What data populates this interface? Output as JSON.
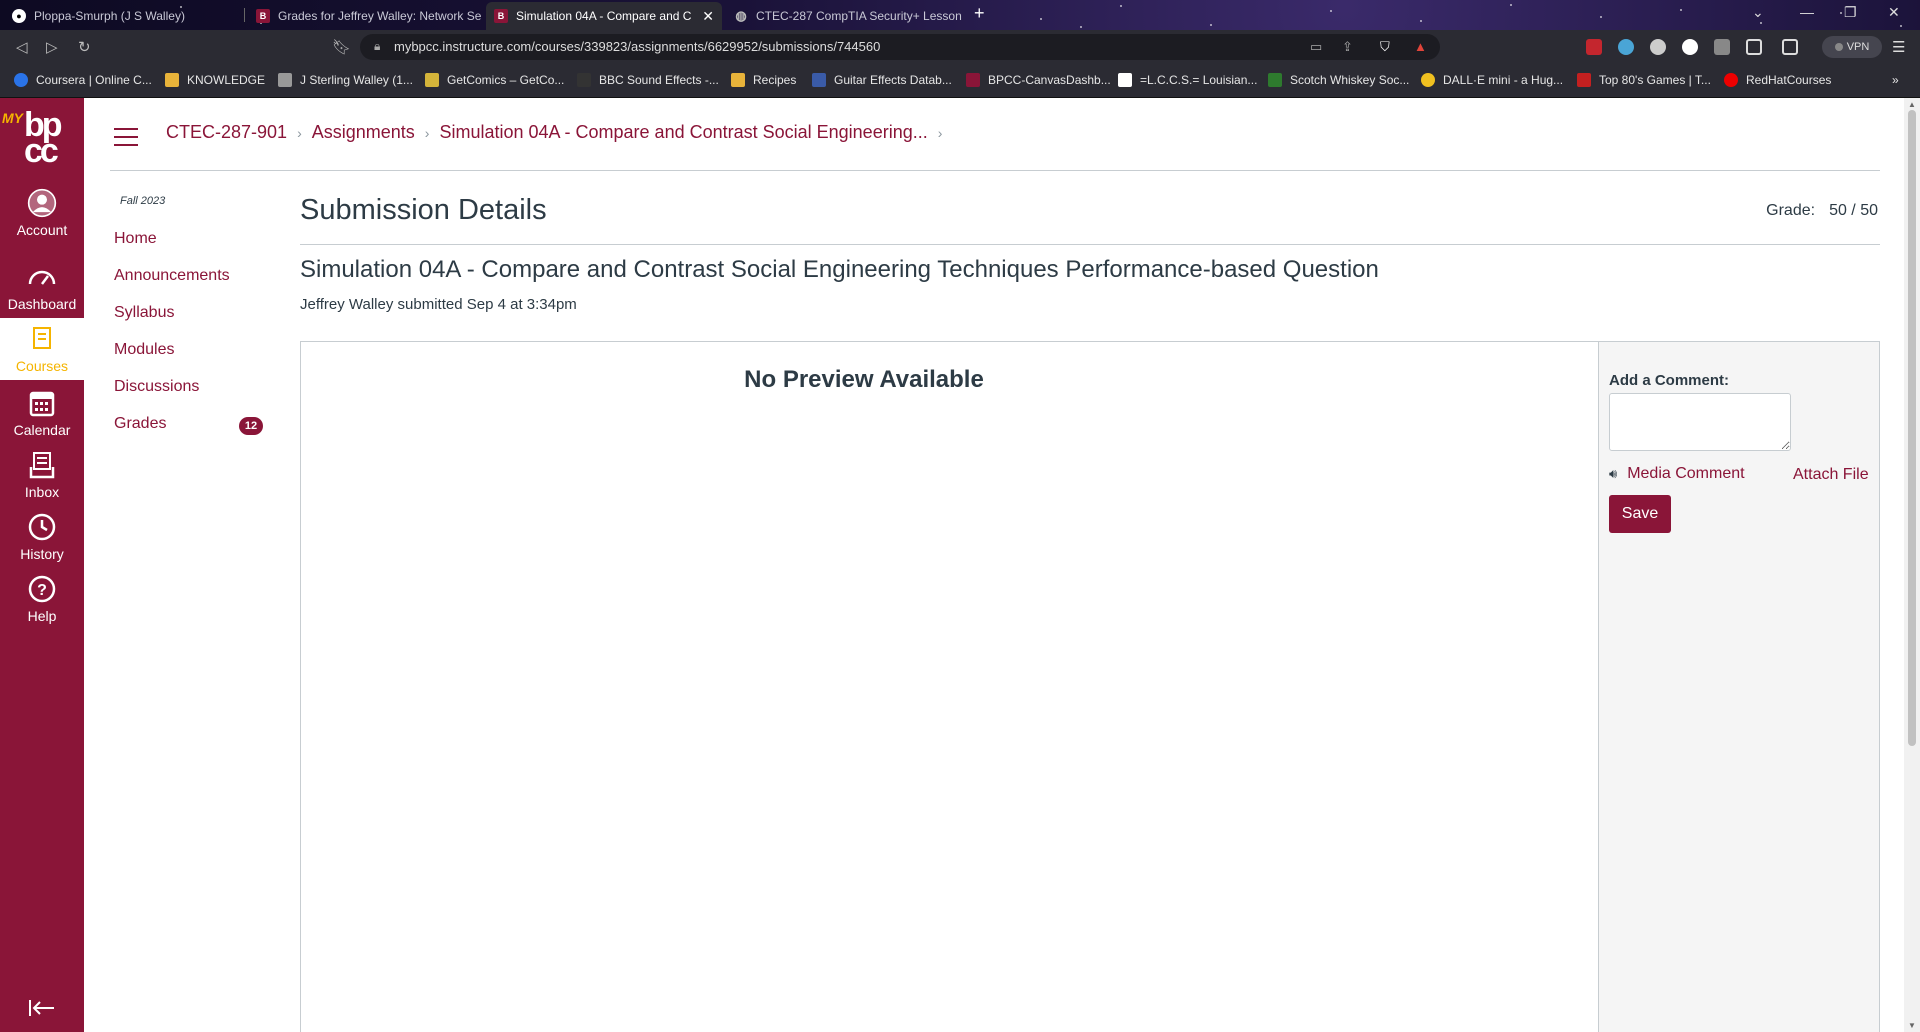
{
  "browser": {
    "tabs": [
      {
        "label": "Ploppa-Smurph (J S Walley)",
        "icon": "github-icon"
      },
      {
        "label": "Grades for Jeffrey Walley: Network Se",
        "icon": "canvas-icon"
      },
      {
        "label": "Simulation 04A - Compare and C",
        "icon": "canvas-icon",
        "active": true
      },
      {
        "label": "CTEC-287 CompTIA Security+ Lesson",
        "icon": "globe-icon"
      }
    ],
    "url": "mybpcc.instructure.com/courses/339823/assignments/6629952/submissions/744560",
    "vpn_label": "VPN",
    "bookmarks": [
      "Coursera | Online C...",
      "KNOWLEDGE",
      "J Sterling Walley (1...",
      "GetComics – GetCo...",
      "BBC Sound Effects -...",
      "Recipes",
      "Guitar Effects Datab...",
      "BPCC-CanvasDashb...",
      "=L.C.C.S.= Louisian...",
      "Scotch Whiskey Soc...",
      "DALL·E mini - a Hug...",
      "Top 80's Games | T...",
      "RedHatCourses"
    ]
  },
  "global_nav": {
    "logo": {
      "my": "MY",
      "line1": "bp",
      "line2": "cc"
    },
    "items": [
      {
        "label": "Account",
        "icon": "account-icon"
      },
      {
        "label": "Dashboard",
        "icon": "dashboard-icon"
      },
      {
        "label": "Courses",
        "icon": "courses-icon",
        "active": true
      },
      {
        "label": "Calendar",
        "icon": "calendar-icon"
      },
      {
        "label": "Inbox",
        "icon": "inbox-icon"
      },
      {
        "label": "History",
        "icon": "history-icon"
      },
      {
        "label": "Help",
        "icon": "help-icon"
      }
    ]
  },
  "breadcrumb": {
    "course": "CTEC-287-901",
    "assignments": "Assignments",
    "assignment": "Simulation 04A - Compare and Contrast Social Engineering..."
  },
  "course_nav": {
    "term": "Fall 2023",
    "items": [
      {
        "label": "Home"
      },
      {
        "label": "Announcements"
      },
      {
        "label": "Syllabus"
      },
      {
        "label": "Modules"
      },
      {
        "label": "Discussions"
      },
      {
        "label": "Grades",
        "badge": "12"
      }
    ]
  },
  "submission": {
    "heading": "Submission Details",
    "grade_label": "Grade:",
    "grade_value": "50 / 50",
    "assignment_title": "Simulation 04A - Compare and Contrast Social Engineering Techniques Performance-based Question",
    "submitted_text": "Jeffrey Walley submitted Sep 4 at 3:34pm",
    "preview_text": "No Preview Available"
  },
  "comment": {
    "label": "Add a Comment:",
    "media_comment": "Media Comment",
    "attach_file": "Attach File",
    "save": "Save"
  },
  "colors": {
    "brand": "#8a1538",
    "accent": "#f5b400"
  }
}
